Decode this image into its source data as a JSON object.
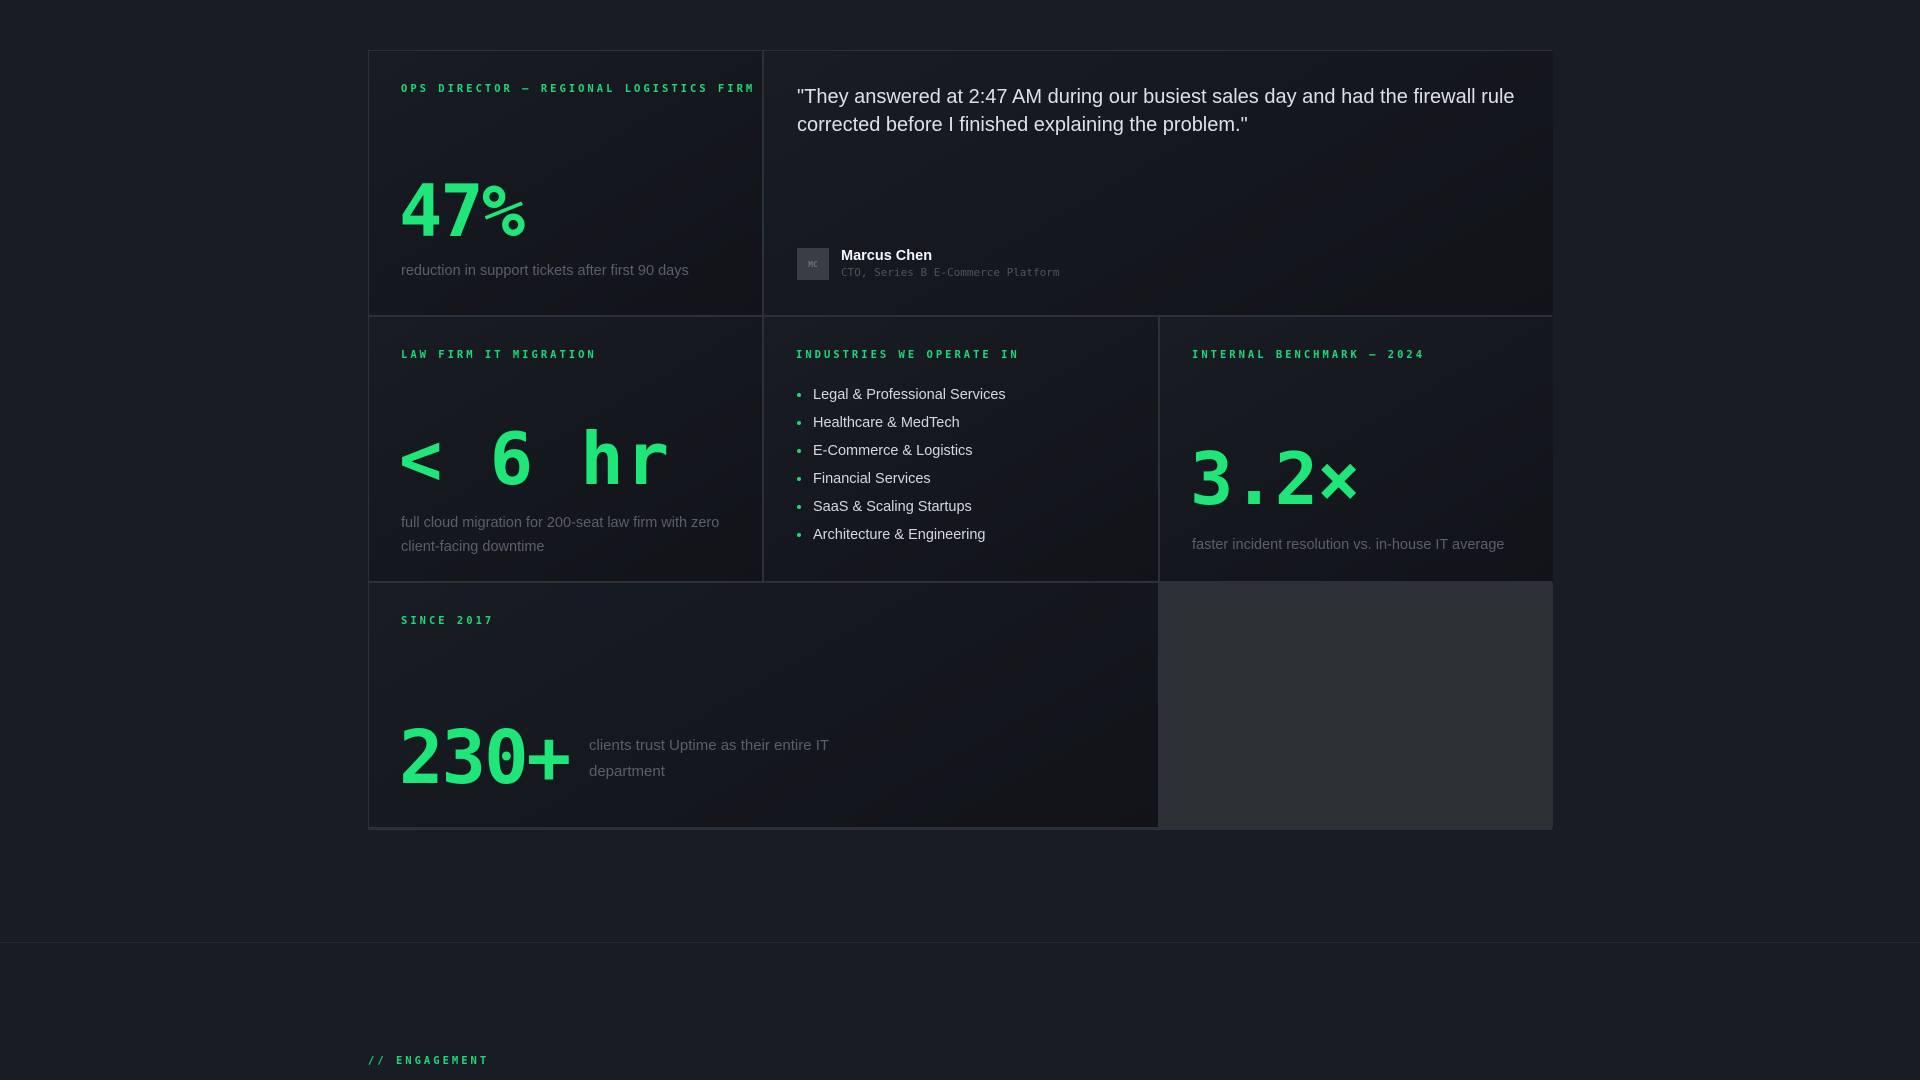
{
  "cards": {
    "tickets": {
      "kicker": "OPS DIRECTOR — REGIONAL LOGISTICS FIRM",
      "stat": "47%",
      "desc": "reduction in support tickets after first 90 days"
    },
    "testimonial": {
      "quote": "\"They answered at 2:47 AM during our busiest sales day and had the firewall rule corrected before I finished explaining the problem.\"",
      "avatar_initials": "MC",
      "name": "Marcus Chen",
      "role": "CTO, Series B E-Commerce Platform"
    },
    "migration": {
      "kicker": "LAW FIRM IT MIGRATION",
      "stat": "< 6 hr",
      "desc": "full cloud migration for 200-seat law firm with zero client-facing downtime"
    },
    "industries": {
      "kicker": "INDUSTRIES WE OPERATE IN",
      "items": [
        "Legal & Professional Services",
        "Healthcare & MedTech",
        "E-Commerce & Logistics",
        "Financial Services",
        "SaaS & Scaling Startups",
        "Architecture & Engineering"
      ]
    },
    "benchmark": {
      "kicker": "INTERNAL BENCHMARK — 2024",
      "stat": "3.2×",
      "desc": "faster incident resolution vs. in-house IT average"
    },
    "clients": {
      "kicker": "SINCE 2017",
      "stat": "230+",
      "desc": "clients trust Uptime as their entire IT department"
    }
  },
  "next_section": {
    "label": "// ENGAGEMENT"
  },
  "colors": {
    "accent": "#1ee679",
    "background": "#181c25",
    "muted_text": "#5a5f69"
  }
}
